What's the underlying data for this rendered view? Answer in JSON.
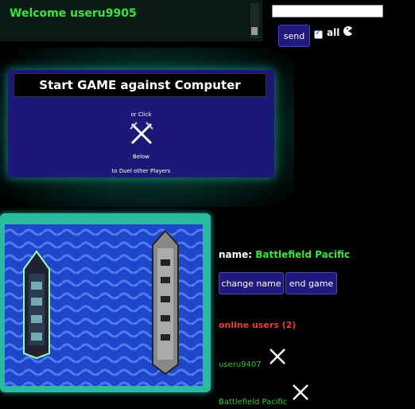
{
  "chat": {
    "welcome": "Welcome useru9905",
    "send_label": "send",
    "all_label": "all",
    "all_checked": true
  },
  "start": {
    "button_label": "Start GAME against Computer",
    "or_click": "or Click",
    "below": "Below",
    "duel_text": "to Duel other Players"
  },
  "player": {
    "name_label": "name:",
    "name_value": "Battlefield Pacific",
    "change_name_label": "change name",
    "end_game_label": "end game"
  },
  "online": {
    "title": "online users (2)",
    "users": [
      "useru9407",
      "Battlefield Pacific"
    ]
  },
  "colors": {
    "accent_green": "#39e639",
    "button_bg": "#201a7a",
    "water": "#1f46c8",
    "frame": "#2bbaa0",
    "online_title": "#e8402a"
  },
  "icons": [
    "swords-icon",
    "ship-icon",
    "duel-x-icon",
    "emoji-icon"
  ]
}
